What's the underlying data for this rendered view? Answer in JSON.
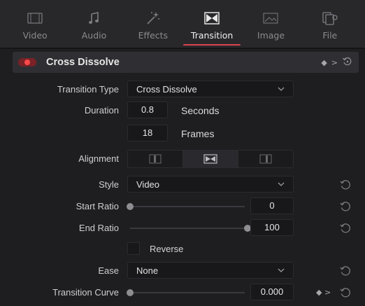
{
  "tabs": [
    {
      "label": "Video",
      "icon": "video-icon",
      "active": false
    },
    {
      "label": "Audio",
      "icon": "music-note-icon",
      "active": false
    },
    {
      "label": "Effects",
      "icon": "magic-wand-icon",
      "active": false
    },
    {
      "label": "Transition",
      "icon": "transition-icon",
      "active": true
    },
    {
      "label": "Image",
      "icon": "image-icon",
      "active": false
    },
    {
      "label": "File",
      "icon": "file-icon",
      "active": false
    }
  ],
  "header": {
    "title": "Cross Dissolve",
    "keyframe_glyph": "◆",
    "nav_glyph": ">"
  },
  "fields": {
    "transition_type": {
      "label": "Transition Type",
      "value": "Cross Dissolve"
    },
    "duration": {
      "label": "Duration",
      "seconds_value": "0.8",
      "seconds_unit": "Seconds",
      "frames_value": "18",
      "frames_unit": "Frames"
    },
    "alignment": {
      "label": "Alignment",
      "selected": "center"
    },
    "style": {
      "label": "Style",
      "value": "Video"
    },
    "start_ratio": {
      "label": "Start Ratio",
      "value": "0",
      "fraction": 0
    },
    "end_ratio": {
      "label": "End Ratio",
      "value": "100",
      "fraction": 1
    },
    "reverse": {
      "label": "Reverse",
      "checked": false
    },
    "ease": {
      "label": "Ease",
      "value": "None"
    },
    "transition_curve": {
      "label": "Transition Curve",
      "value": "0.000",
      "fraction": 0,
      "keyframe_glyph": "◆",
      "nav_glyph": ">"
    }
  },
  "colors": {
    "accent": "#d9434a",
    "toggle_on": "#ff4a4a",
    "panel_bg": "#1e1e21"
  }
}
